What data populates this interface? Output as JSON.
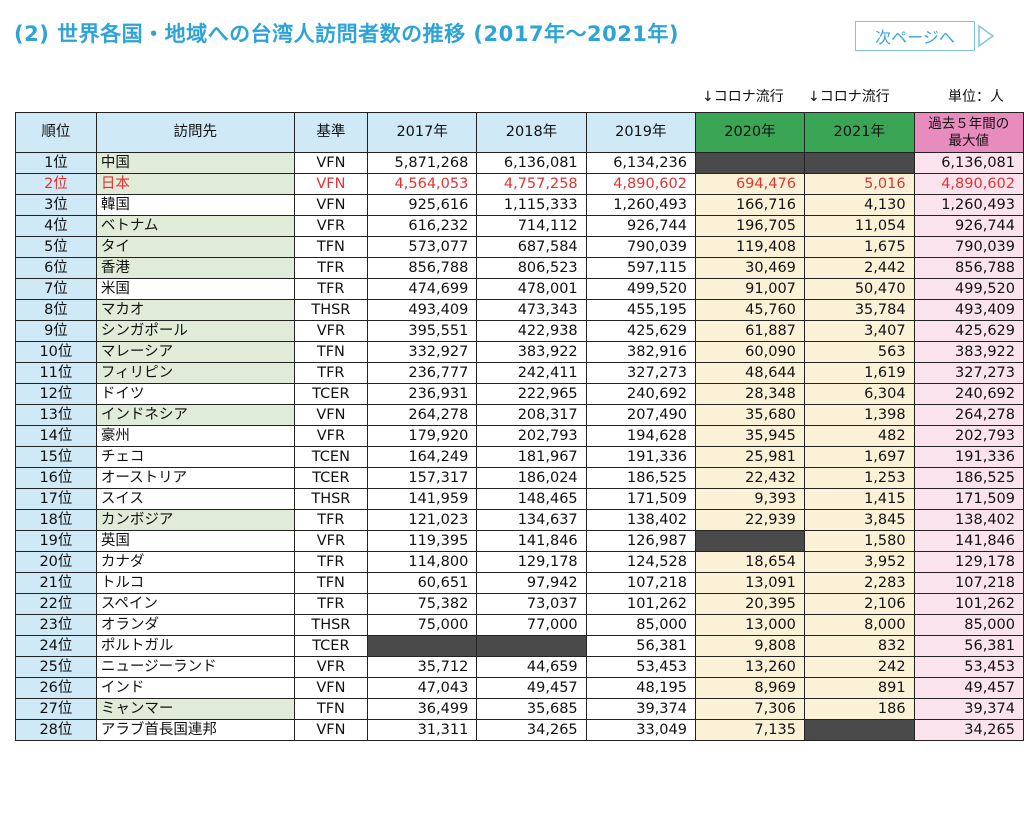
{
  "title": "(2) 世界各国・地域への台湾人訪問者数の推移 (2017年～2021年)",
  "next_page_label": "次ページへ",
  "notes": {
    "covid_2020": "↓コロナ流行",
    "covid_2021": "↓コロナ流行",
    "unit": "単位：人"
  },
  "headers": [
    "順位",
    "訪問先",
    "基準",
    "2017年",
    "2018年",
    "2019年",
    "2020年",
    "2021年",
    "過去５年間の 最大値"
  ],
  "rows": [
    {
      "rank": "1位",
      "dest": "中国",
      "basis": "VFN",
      "y2017": "5,871,268",
      "y2018": "6,136,081",
      "y2019": "6,134,236",
      "y2020": "",
      "y2021": "",
      "max": "6,136,081"
    },
    {
      "rank": "2位",
      "dest": "日本",
      "basis": "VFN",
      "y2017": "4,564,053",
      "y2018": "4,757,258",
      "y2019": "4,890,602",
      "y2020": "694,476",
      "y2021": "5,016",
      "max": "4,890,602"
    },
    {
      "rank": "3位",
      "dest": "韓国",
      "basis": "VFN",
      "y2017": "925,616",
      "y2018": "1,115,333",
      "y2019": "1,260,493",
      "y2020": "166,716",
      "y2021": "4,130",
      "max": "1,260,493"
    },
    {
      "rank": "4位",
      "dest": "ベトナム",
      "basis": "VFR",
      "y2017": "616,232",
      "y2018": "714,112",
      "y2019": "926,744",
      "y2020": "196,705",
      "y2021": "11,054",
      "max": "926,744"
    },
    {
      "rank": "5位",
      "dest": "タイ",
      "basis": "TFN",
      "y2017": "573,077",
      "y2018": "687,584",
      "y2019": "790,039",
      "y2020": "119,408",
      "y2021": "1,675",
      "max": "790,039"
    },
    {
      "rank": "6位",
      "dest": "香港",
      "basis": "TFR",
      "y2017": "856,788",
      "y2018": "806,523",
      "y2019": "597,115",
      "y2020": "30,469",
      "y2021": "2,442",
      "max": "856,788"
    },
    {
      "rank": "7位",
      "dest": "米国",
      "basis": "TFR",
      "y2017": "474,699",
      "y2018": "478,001",
      "y2019": "499,520",
      "y2020": "91,007",
      "y2021": "50,470",
      "max": "499,520"
    },
    {
      "rank": "8位",
      "dest": "マカオ",
      "basis": "THSR",
      "y2017": "493,409",
      "y2018": "473,343",
      "y2019": "455,195",
      "y2020": "45,760",
      "y2021": "35,784",
      "max": "493,409"
    },
    {
      "rank": "9位",
      "dest": "シンガポール",
      "basis": "VFR",
      "y2017": "395,551",
      "y2018": "422,938",
      "y2019": "425,629",
      "y2020": "61,887",
      "y2021": "3,407",
      "max": "425,629"
    },
    {
      "rank": "10位",
      "dest": "マレーシア",
      "basis": "TFN",
      "y2017": "332,927",
      "y2018": "383,922",
      "y2019": "382,916",
      "y2020": "60,090",
      "y2021": "563",
      "max": "383,922"
    },
    {
      "rank": "11位",
      "dest": "フィリピン",
      "basis": "TFR",
      "y2017": "236,777",
      "y2018": "242,411",
      "y2019": "327,273",
      "y2020": "48,644",
      "y2021": "1,619",
      "max": "327,273"
    },
    {
      "rank": "12位",
      "dest": "ドイツ",
      "basis": "TCER",
      "y2017": "236,931",
      "y2018": "222,965",
      "y2019": "240,692",
      "y2020": "28,348",
      "y2021": "6,304",
      "max": "240,692"
    },
    {
      "rank": "13位",
      "dest": "インドネシア",
      "basis": "VFN",
      "y2017": "264,278",
      "y2018": "208,317",
      "y2019": "207,490",
      "y2020": "35,680",
      "y2021": "1,398",
      "max": "264,278"
    },
    {
      "rank": "14位",
      "dest": "豪州",
      "basis": "VFR",
      "y2017": "179,920",
      "y2018": "202,793",
      "y2019": "194,628",
      "y2020": "35,945",
      "y2021": "482",
      "max": "202,793"
    },
    {
      "rank": "15位",
      "dest": "チェコ",
      "basis": "TCEN",
      "y2017": "164,249",
      "y2018": "181,967",
      "y2019": "191,336",
      "y2020": "25,981",
      "y2021": "1,697",
      "max": "191,336"
    },
    {
      "rank": "16位",
      "dest": "オーストリア",
      "basis": "TCER",
      "y2017": "157,317",
      "y2018": "186,024",
      "y2019": "186,525",
      "y2020": "22,432",
      "y2021": "1,253",
      "max": "186,525"
    },
    {
      "rank": "17位",
      "dest": "スイス",
      "basis": "THSR",
      "y2017": "141,959",
      "y2018": "148,465",
      "y2019": "171,509",
      "y2020": "9,393",
      "y2021": "1,415",
      "max": "171,509"
    },
    {
      "rank": "18位",
      "dest": "カンボジア",
      "basis": "TFR",
      "y2017": "121,023",
      "y2018": "134,637",
      "y2019": "138,402",
      "y2020": "22,939",
      "y2021": "3,845",
      "max": "138,402"
    },
    {
      "rank": "19位",
      "dest": "英国",
      "basis": "VFR",
      "y2017": "119,395",
      "y2018": "141,846",
      "y2019": "126,987",
      "y2020": "",
      "y2021": "1,580",
      "max": "141,846"
    },
    {
      "rank": "20位",
      "dest": "カナダ",
      "basis": "TFR",
      "y2017": "114,800",
      "y2018": "129,178",
      "y2019": "124,528",
      "y2020": "18,654",
      "y2021": "3,952",
      "max": "129,178"
    },
    {
      "rank": "21位",
      "dest": "トルコ",
      "basis": "TFN",
      "y2017": "60,651",
      "y2018": "97,942",
      "y2019": "107,218",
      "y2020": "13,091",
      "y2021": "2,283",
      "max": "107,218"
    },
    {
      "rank": "22位",
      "dest": "スペイン",
      "basis": "TFR",
      "y2017": "75,382",
      "y2018": "73,037",
      "y2019": "101,262",
      "y2020": "20,395",
      "y2021": "2,106",
      "max": "101,262"
    },
    {
      "rank": "23位",
      "dest": "オランダ",
      "basis": "THSR",
      "y2017": "75,000",
      "y2018": "77,000",
      "y2019": "85,000",
      "y2020": "13,000",
      "y2021": "8,000",
      "max": "85,000"
    },
    {
      "rank": "24位",
      "dest": "ポルトガル",
      "basis": "TCER",
      "y2017": "",
      "y2018": "",
      "y2019": "56,381",
      "y2020": "9,808",
      "y2021": "832",
      "max": "56,381"
    },
    {
      "rank": "25位",
      "dest": "ニュージーランド",
      "basis": "VFR",
      "y2017": "35,712",
      "y2018": "44,659",
      "y2019": "53,453",
      "y2020": "13,260",
      "y2021": "242",
      "max": "53,453"
    },
    {
      "rank": "26位",
      "dest": "インド",
      "basis": "VFN",
      "y2017": "47,043",
      "y2018": "49,457",
      "y2019": "48,195",
      "y2020": "8,969",
      "y2021": "891",
      "max": "49,457"
    },
    {
      "rank": "27位",
      "dest": "ミャンマー",
      "basis": "TFN",
      "y2017": "36,499",
      "y2018": "35,685",
      "y2019": "39,374",
      "y2020": "7,306",
      "y2021": "186",
      "max": "39,374"
    },
    {
      "rank": "28位",
      "dest": "アラブ首長国連邦",
      "basis": "VFN",
      "y2017": "31,311",
      "y2018": "34,265",
      "y2019": "33,049",
      "y2020": "7,135",
      "y2021": "",
      "max": "34,265"
    }
  ],
  "highlight_rank": "2位",
  "green_dest_rows": [
    "1位",
    "2位",
    "4位",
    "5位",
    "6位",
    "8位",
    "9位",
    "10位",
    "11位",
    "13位",
    "18位",
    "27位"
  ],
  "colors": {
    "title": "#2ea3d6",
    "header_lightblue": "#cfe9f7",
    "header_green": "#3aa655",
    "header_pink": "#e88bbd",
    "dest_green": "#e0ecd8",
    "covid_cols": "#fbf1d6",
    "max_col": "#fbe3ee",
    "japan_text": "#e23333",
    "blank_cell": "#4a4a4a"
  }
}
